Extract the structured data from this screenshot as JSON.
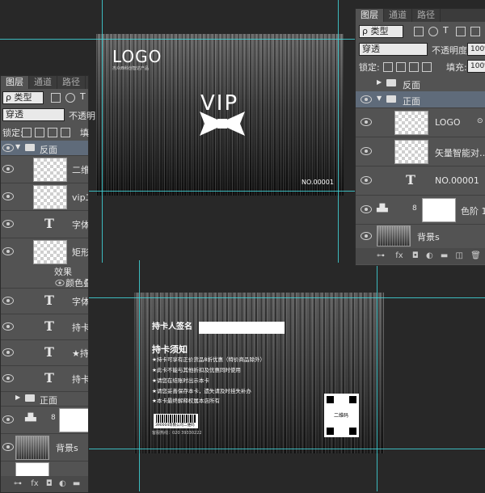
{
  "right_panel": {
    "tabs": [
      "图层",
      "通道",
      "路径"
    ],
    "filter_kind": "ρ 类型",
    "blend_mode": "穿透",
    "opacity_label": "不透明度:",
    "opacity_value": "100%",
    "lock_label": "锁定:",
    "fill_label": "填充:",
    "fill_value": "100%",
    "layers": [
      {
        "name": "反面",
        "type": "group-collapsed"
      },
      {
        "name": "正面",
        "type": "group-open"
      },
      {
        "name": "LOGO",
        "type": "pixel"
      },
      {
        "name": "矢量智能对…",
        "type": "smart"
      },
      {
        "name": "NO.00001",
        "type": "text"
      },
      {
        "name": "色阶 1",
        "type": "adjust"
      },
      {
        "name": "背景s",
        "type": "pixel"
      }
    ]
  },
  "left_panel": {
    "tabs": [
      "图层",
      "通道",
      "路径"
    ],
    "filter_kind": "ρ 类型",
    "blend_mode": "穿透",
    "opacity_label": "不透明",
    "lock_label": "锁定:",
    "fill_label": "填",
    "layers": [
      {
        "name": "反面",
        "type": "group-open"
      },
      {
        "name": "二维",
        "type": "pixel"
      },
      {
        "name": "vip二",
        "type": "pixel"
      },
      {
        "name": "字体",
        "type": "text"
      },
      {
        "name": "矩形",
        "type": "shape"
      },
      {
        "name": "效果",
        "type": "effect"
      },
      {
        "name": "颜色叠加",
        "type": "effect-item"
      },
      {
        "name": "字体",
        "type": "text"
      },
      {
        "name": "持卡",
        "type": "text"
      },
      {
        "name": "★持",
        "type": "text"
      },
      {
        "name": "持卡",
        "type": "text"
      },
      {
        "name": "正面",
        "type": "group-collapsed"
      },
      {
        "name": "",
        "type": "adjust"
      },
      {
        "name": "背景s",
        "type": "pixel"
      }
    ]
  },
  "front_card": {
    "logo": "LOGO",
    "company": "杰众西科创智达产品",
    "vip": "VIP",
    "number": "NO.00001"
  },
  "back_card": {
    "signature_label": "持卡人签名",
    "notice_title": "持卡须知",
    "rules": [
      "★持卡可享有正价货品8折优惠（特价商品除外）",
      "★此卡不能与其他折扣及优惠同时使用",
      "★请您在结账时出示本卡",
      "★请您妥善保存本卡，遗失请及时挂失补办",
      "★本卡最终解释权属本店所有"
    ],
    "barcode_text": "390004等数公司二维码",
    "hotline": "客服热线：020 39330222",
    "qr_label": "二维码"
  }
}
